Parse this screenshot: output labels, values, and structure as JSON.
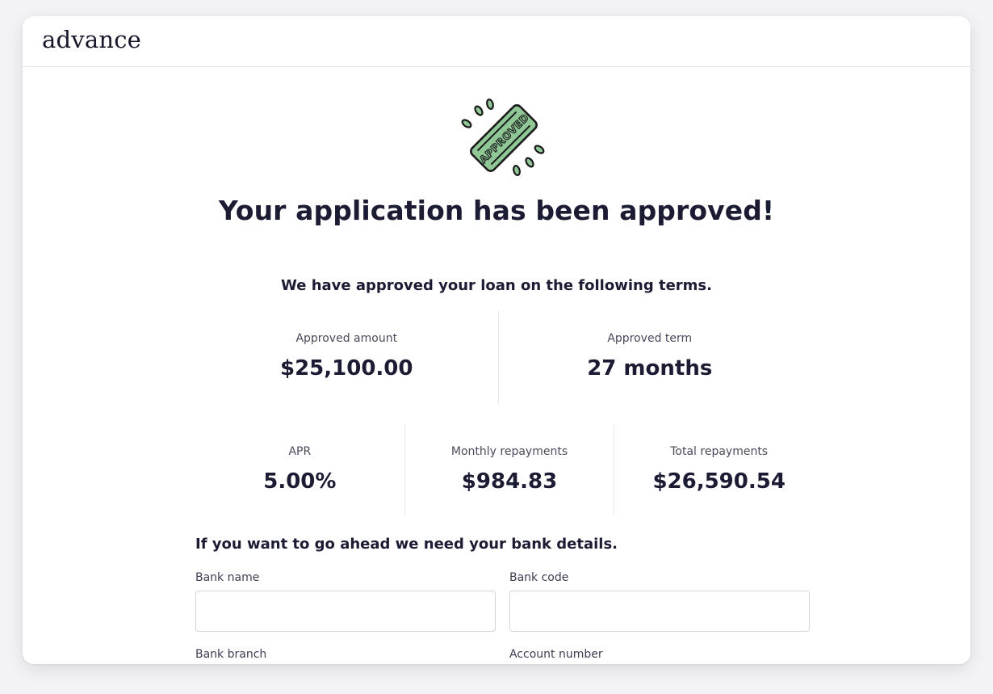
{
  "brand": {
    "name": "advance"
  },
  "badge": {
    "text": "APPROVED",
    "fill": "#8fc896",
    "stroke": "#1b1b1b",
    "icon": "approved-stamp-icon"
  },
  "headline": "Your application has been approved!",
  "intro": "We have approved your loan on the following terms.",
  "terms_primary": [
    {
      "label": "Approved amount",
      "value": "$25,100.00"
    },
    {
      "label": "Approved term",
      "value": "27 months"
    }
  ],
  "terms_secondary": [
    {
      "label": "APR",
      "value": "5.00%"
    },
    {
      "label": "Monthly repayments",
      "value": "$984.83"
    },
    {
      "label": "Total repayments",
      "value": "$26,590.54"
    }
  ],
  "bank": {
    "heading": "If you want to go ahead we need your bank details.",
    "fields": {
      "bank_name": {
        "label": "Bank name",
        "value": "",
        "placeholder": ""
      },
      "bank_code": {
        "label": "Bank code",
        "value": "",
        "placeholder": ""
      },
      "bank_branch": {
        "label": "Bank branch"
      },
      "account_number": {
        "label": "Account number"
      }
    }
  },
  "colors": {
    "text": "#1b1b34",
    "divider": "#e8e8ec",
    "input_border": "#d4d4dc"
  }
}
